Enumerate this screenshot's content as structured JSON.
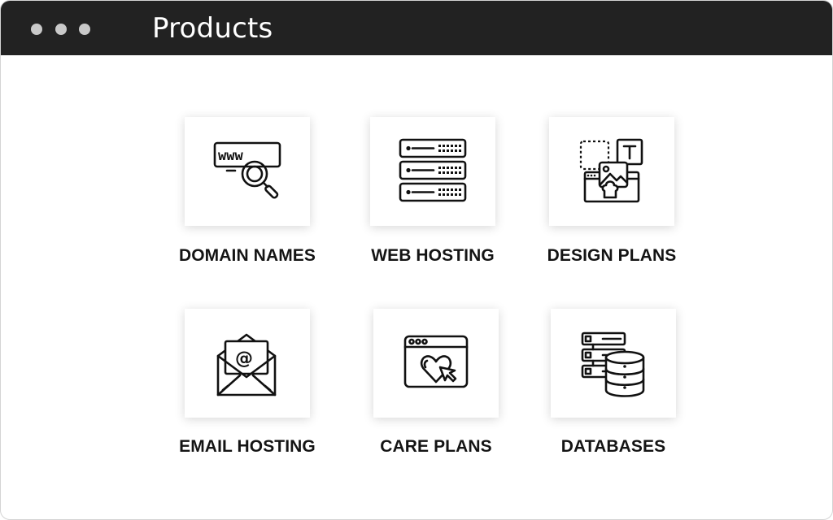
{
  "window": {
    "title": "Products"
  },
  "products": [
    {
      "label": "DOMAIN NAMES",
      "icon": "www-search-icon"
    },
    {
      "label": "WEB HOSTING",
      "icon": "server-rack-icon"
    },
    {
      "label": "DESIGN PLANS",
      "icon": "design-tools-icon"
    },
    {
      "label": "EMAIL HOSTING",
      "icon": "email-envelope-icon"
    },
    {
      "label": "CARE PLANS",
      "icon": "browser-heart-icon"
    },
    {
      "label": "DATABASES",
      "icon": "database-server-icon"
    }
  ],
  "colors": {
    "titlebar": "#222222",
    "dots": "#c9c9c9",
    "label": "#141414"
  }
}
